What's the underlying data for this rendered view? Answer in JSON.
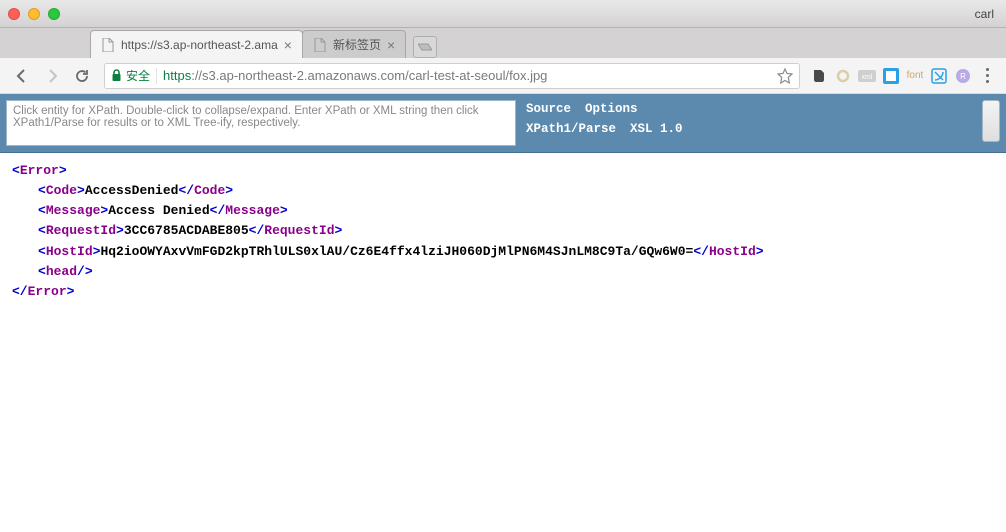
{
  "window": {
    "user": "carl"
  },
  "tabs": [
    {
      "title": "https://s3.ap-northeast-2.ama",
      "active": true
    },
    {
      "title": "新标签页",
      "active": false
    }
  ],
  "omnibox": {
    "secure_label": "安全",
    "url_https": "https",
    "url_rest": "://s3.ap-northeast-2.amazonaws.com/carl-test-at-seoul/fox.jpg"
  },
  "xmlviewer": {
    "placeholder": "Click entity for XPath. Double-click to collapse/expand. Enter XPath or XML string then click XPath1/Parse for results or to XML Tree-ify, respectively.",
    "menu": {
      "source": "Source",
      "options": "Options",
      "xpath": "XPath1/Parse",
      "xsl": "XSL 1.0"
    }
  },
  "xml": {
    "root": "Error",
    "code_tag": "Code",
    "code_val": "AccessDenied",
    "message_tag": "Message",
    "message_val": "Access Denied",
    "requestid_tag": "RequestId",
    "requestid_val": "3CC6785ACDABE805",
    "hostid_tag": "HostId",
    "hostid_val": "Hq2ioOWYAxvVmFGD2kpTRhlULS0xlAU/Cz6E4ffx4lziJH060DjMlPN6M4SJnLM8C9Ta/GQw6W0=",
    "head_tag": "head"
  }
}
